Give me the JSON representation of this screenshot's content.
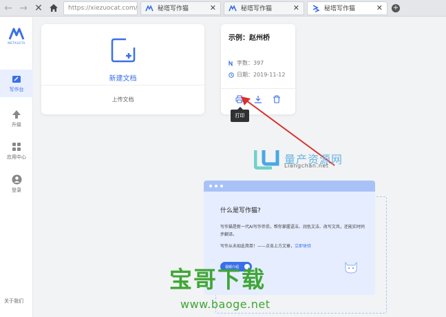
{
  "browser": {
    "url": "https://xiezuocat.com/#/",
    "tabs": [
      {
        "title": "秘塔写作猫",
        "active": false
      },
      {
        "title": "秘塔写作猫",
        "active": false
      },
      {
        "title": "秘塔写作猫",
        "active": true
      }
    ]
  },
  "sidebar": {
    "brand": "METASOTA",
    "items": [
      {
        "label": "写作台",
        "icon": "pen-icon",
        "active": true
      },
      {
        "label": "升级",
        "icon": "up-arrow-icon",
        "active": false
      },
      {
        "label": "应用中心",
        "icon": "grid-icon",
        "active": false
      },
      {
        "label": "登录",
        "icon": "user-icon",
        "active": false
      }
    ],
    "footer": "关于我们"
  },
  "new_doc": {
    "label": "新建文档",
    "upload": "上传文档"
  },
  "example": {
    "title": "示例：赵州桥",
    "word_count": "字数：397",
    "date": "日期：2019-11-12",
    "tooltip": "打印"
  },
  "info": {
    "title": "什么是写作猫?",
    "p1": "写作猫是新一代AI写作伴侣，帮你掌握语法、润色文法、改写文风，还能实时同步翻译。",
    "p2_prefix": "写作从未如此简单！——点击上方文章，",
    "p2_link": "立即体验",
    "video_button": "视频介绍"
  },
  "watermark": {
    "top_text": "量产资源网",
    "top_sub": "Liangchan.net",
    "big_text": "宝哥下载",
    "big_url": "www.baoge.net"
  },
  "colors": {
    "accent": "#3a6fe8",
    "watermark_green": "#3fa635",
    "arrow": "#d9302c"
  }
}
